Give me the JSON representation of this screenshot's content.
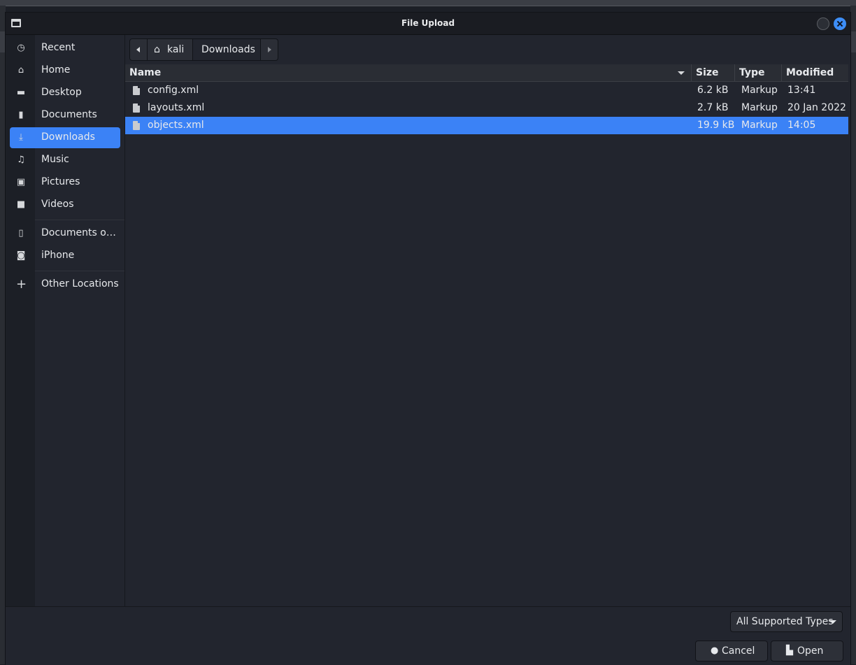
{
  "dialog": {
    "title": "File Upload"
  },
  "sidebar": {
    "items": [
      {
        "label": "Recent",
        "icon": "clock-icon",
        "glyph": "◷"
      },
      {
        "label": "Home",
        "icon": "home-icon",
        "glyph": "⌂"
      },
      {
        "label": "Desktop",
        "icon": "desktop-icon",
        "glyph": "▬"
      },
      {
        "label": "Documents",
        "icon": "document-icon",
        "glyph": "▮"
      },
      {
        "label": "Downloads",
        "icon": "download-icon",
        "glyph": "⤓"
      },
      {
        "label": "Music",
        "icon": "music-icon",
        "glyph": "♫"
      },
      {
        "label": "Pictures",
        "icon": "picture-icon",
        "glyph": "▣"
      },
      {
        "label": "Videos",
        "icon": "video-icon",
        "glyph": "■"
      },
      {
        "label": "Documents o…",
        "icon": "phone-icon",
        "glyph": "▯"
      },
      {
        "label": "iPhone",
        "icon": "camera-icon",
        "glyph": "◙"
      },
      {
        "label": "Other Locations",
        "icon": "plus-icon",
        "glyph": "+"
      }
    ],
    "active": "Downloads"
  },
  "pathbar": {
    "home_label": "kali",
    "home_glyph": "⌂",
    "current": "Downloads"
  },
  "columns": {
    "name": "Name",
    "size": "Size",
    "type": "Type",
    "modified": "Modified"
  },
  "files": [
    {
      "name": "config.xml",
      "size": "6.2 kB",
      "type": "Markup",
      "modified": "13:41",
      "selected": false
    },
    {
      "name": "layouts.xml",
      "size": "2.7 kB",
      "type": "Markup",
      "modified": "20 Jan 2022",
      "selected": false
    },
    {
      "name": "objects.xml",
      "size": "19.9 kB",
      "type": "Markup",
      "modified": "14:05",
      "selected": true
    }
  ],
  "footer": {
    "filter": "All Supported Types",
    "cancel": "Cancel",
    "cancel_glyph": "●",
    "open": "Open",
    "open_glyph": "▙"
  },
  "colors": {
    "accent": "#3b82f6",
    "background": "#22252e"
  }
}
